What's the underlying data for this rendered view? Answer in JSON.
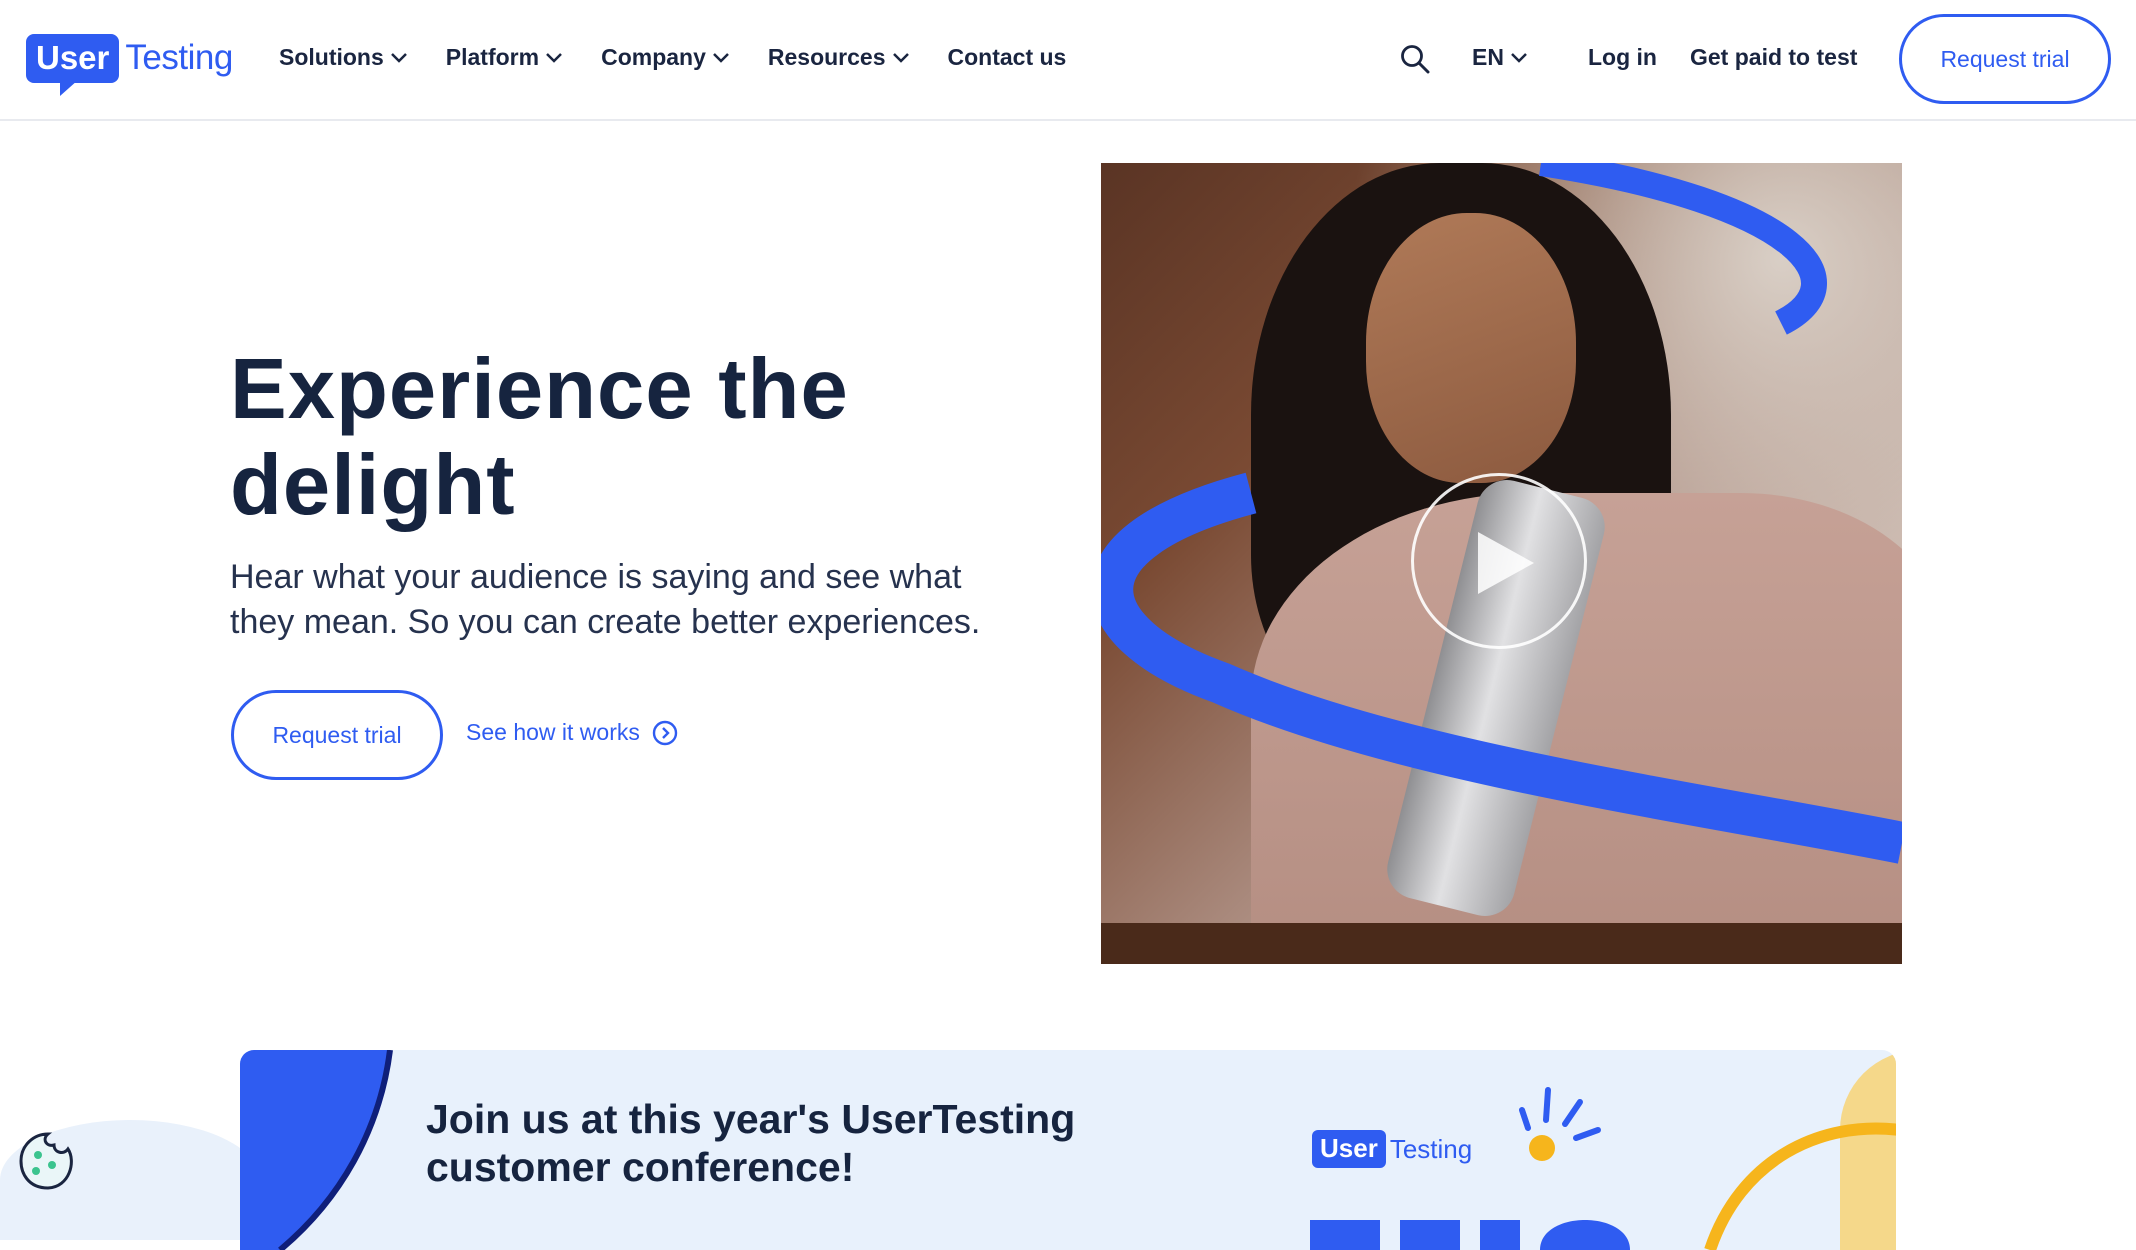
{
  "header": {
    "logo": {
      "user": "User",
      "testing": "Testing"
    },
    "nav": [
      {
        "label": "Solutions",
        "has_dropdown": true
      },
      {
        "label": "Platform",
        "has_dropdown": true
      },
      {
        "label": "Company",
        "has_dropdown": true
      },
      {
        "label": "Resources",
        "has_dropdown": true
      },
      {
        "label": "Contact us",
        "has_dropdown": false
      }
    ],
    "language": "EN",
    "login": "Log in",
    "get_paid": "Get paid to test",
    "request_trial": "Request trial"
  },
  "hero": {
    "title": "Experience the delight",
    "subtitle": "Hear what your audience is saying and see what they mean. So you can create better experiences.",
    "request_trial": "Request trial",
    "see_how": "See how it works"
  },
  "banner": {
    "title": "Join us at this year's UserTesting customer conference!",
    "logo": {
      "user": "User",
      "testing": "Testing"
    }
  },
  "colors": {
    "brand_blue": "#2f5cf1",
    "heading_navy": "#16243f",
    "banner_bg": "#e8f1fc",
    "accent_yellow": "#f5d88a"
  },
  "icons": {
    "search": "search-icon",
    "chevron": "chevron-down-icon",
    "play": "play-icon",
    "arrow_circle": "arrow-right-circle-icon",
    "cookie": "cookie-icon"
  }
}
